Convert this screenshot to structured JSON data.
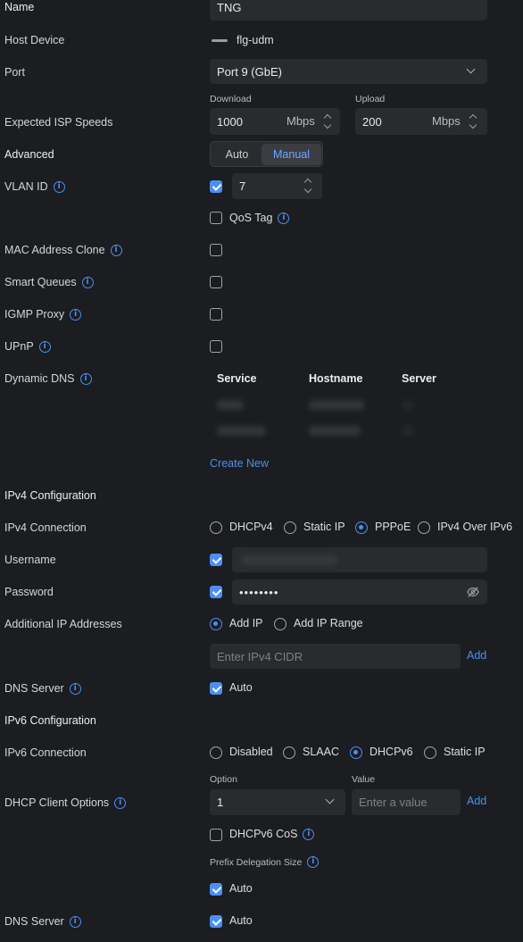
{
  "name": {
    "label": "Name",
    "value": "TNG"
  },
  "host_device": {
    "label": "Host Device",
    "value": "flg-udm"
  },
  "port": {
    "label": "Port",
    "value": "Port 9 (GbE)"
  },
  "isp_speeds": {
    "label": "Expected ISP Speeds",
    "download_label": "Download",
    "download_value": "1000",
    "download_unit": "Mbps",
    "upload_label": "Upload",
    "upload_value": "200",
    "upload_unit": "Mbps"
  },
  "advanced": {
    "label": "Advanced",
    "auto": "Auto",
    "manual": "Manual",
    "selected": "Manual"
  },
  "vlan": {
    "label": "VLAN ID",
    "value": "7",
    "qos_label": "QoS Tag"
  },
  "mac_clone": {
    "label": "MAC Address Clone"
  },
  "smart_queues": {
    "label": "Smart Queues"
  },
  "igmp_proxy": {
    "label": "IGMP Proxy"
  },
  "upnp": {
    "label": "UPnP"
  },
  "ddns": {
    "label": "Dynamic DNS",
    "columns": [
      "Service",
      "Hostname",
      "Server"
    ],
    "create_new": "Create New"
  },
  "ipv4": {
    "section": "IPv4 Configuration",
    "conn_label": "IPv4 Connection",
    "options": [
      "DHCPv4",
      "Static IP",
      "PPPoE",
      "IPv4 Over IPv6"
    ],
    "selected": "PPPoE",
    "username_label": "Username",
    "password_label": "Password",
    "password_value": "••••••••",
    "additional_label": "Additional IP Addresses",
    "add_ip": "Add IP",
    "add_ip_range": "Add IP Range",
    "cidr_placeholder": "Enter IPv4 CIDR",
    "add": "Add",
    "dns_label": "DNS Server",
    "dns_auto": "Auto"
  },
  "ipv6": {
    "section": "IPv6 Configuration",
    "conn_label": "IPv6 Connection",
    "options": [
      "Disabled",
      "SLAAC",
      "DHCPv6",
      "Static IP"
    ],
    "selected": "DHCPv6",
    "client_options_label": "DHCP Client Options",
    "option_label": "Option",
    "option_value": "1",
    "value_label": "Value",
    "value_placeholder": "Enter a value",
    "add": "Add",
    "cos_label": "DHCPv6 CoS",
    "prefix_label": "Prefix Delegation Size",
    "prefix_auto": "Auto",
    "dns_label": "DNS Server",
    "dns_auto": "Auto"
  },
  "colors": {
    "accent": "#4b8ff5",
    "background": "#1c1d20",
    "field": "#2a2b2f"
  }
}
